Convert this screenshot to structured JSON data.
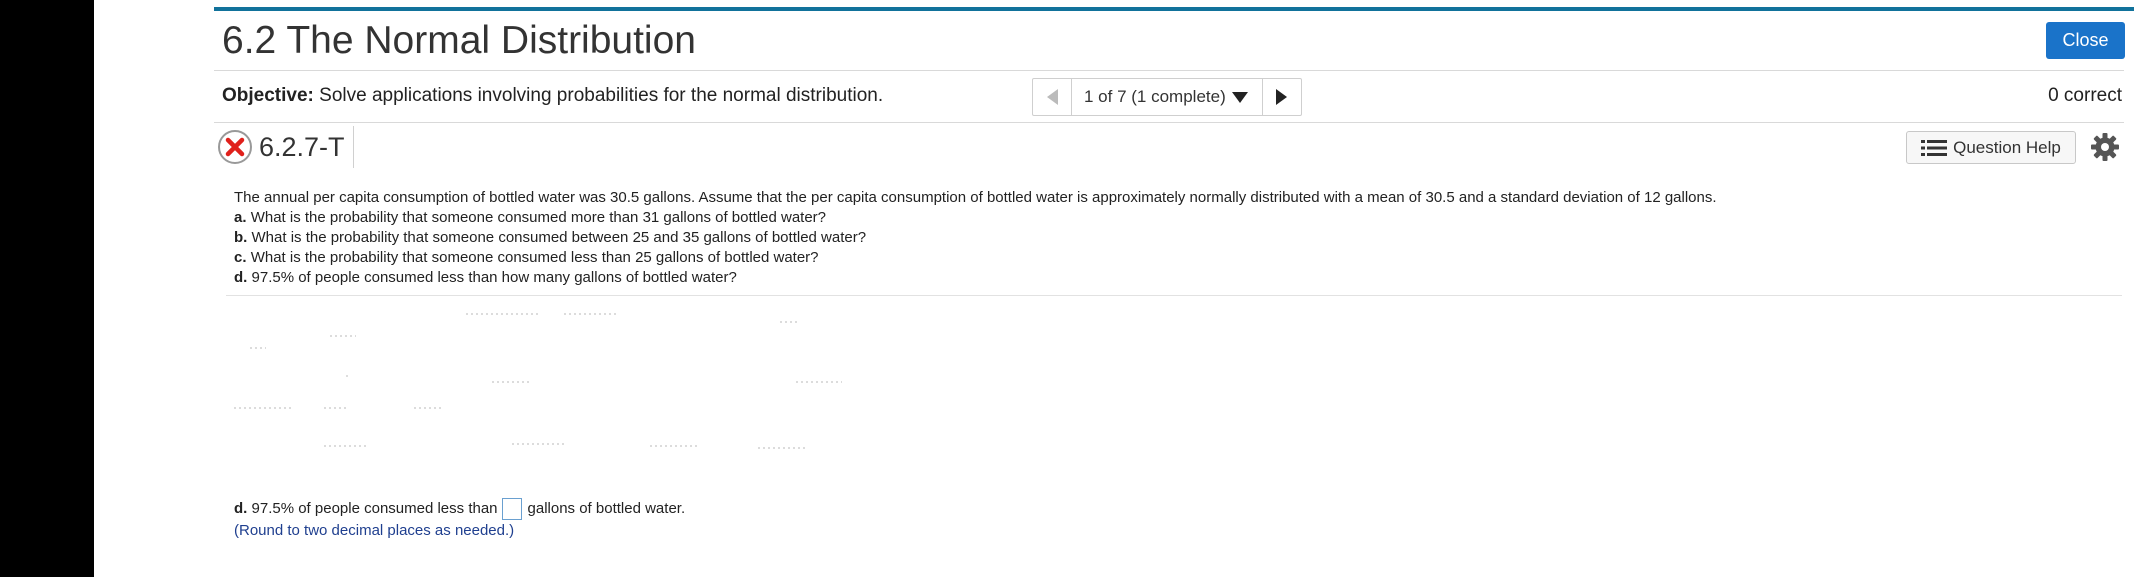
{
  "header": {
    "title": "6.2 The Normal Distribution",
    "close_label": "Close"
  },
  "objective": {
    "label": "Objective:",
    "text": "Solve applications involving probabilities for the normal distribution."
  },
  "navigation": {
    "status": "1 of 7 (1 complete)"
  },
  "score": "0 correct",
  "question": {
    "id": "6.2.7-T",
    "help_label": "Question Help",
    "intro": "The annual per capita consumption of bottled water was 30.5 gallons. Assume that the per capita consumption of bottled water is approximately normally distributed with a mean of 30.5 and a standard deviation of 12 gallons.",
    "parts": [
      {
        "label": "a.",
        "text": "What is the probability that someone consumed more than 31 gallons of bottled water?"
      },
      {
        "label": "b.",
        "text": "What is the probability that someone consumed between 25 and 35 gallons of bottled water?"
      },
      {
        "label": "c.",
        "text": "What is the probability that someone consumed less than 25 gallons of bottled water?"
      },
      {
        "label": "d.",
        "text": "97.5% of people consumed less than how many gallons of bottled water?"
      }
    ]
  },
  "answer": {
    "label": "d.",
    "prefix": "97.5% of people consumed less than",
    "input_value": "",
    "suffix": "gallons of bottled water.",
    "note": "(Round to two decimal places as needed.)"
  },
  "colors": {
    "accent_rule": "#11729b",
    "close_button": "#1a73c9",
    "error_icon": "#e0201b",
    "note_text": "#1f3f8f"
  }
}
